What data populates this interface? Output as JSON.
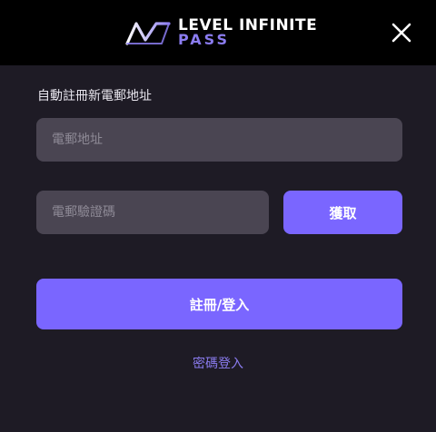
{
  "header": {
    "logo_line1": "LEVEL INFINITE",
    "logo_line2": "PASS",
    "logo_icon": "level-infinite-mark-icon",
    "close_icon": "close-icon"
  },
  "form": {
    "section_label": "自動註冊新電郵地址",
    "email_placeholder": "電郵地址",
    "code_placeholder": "電郵驗證碼",
    "get_code_label": "獲取",
    "register_label": "註冊/登入",
    "password_login_label": "密碼登入"
  },
  "colors": {
    "background": "#1e1b25",
    "header": "#000000",
    "accent": "#7a66ff",
    "input_bg": "#4a4552",
    "link": "#8b7cf0"
  }
}
